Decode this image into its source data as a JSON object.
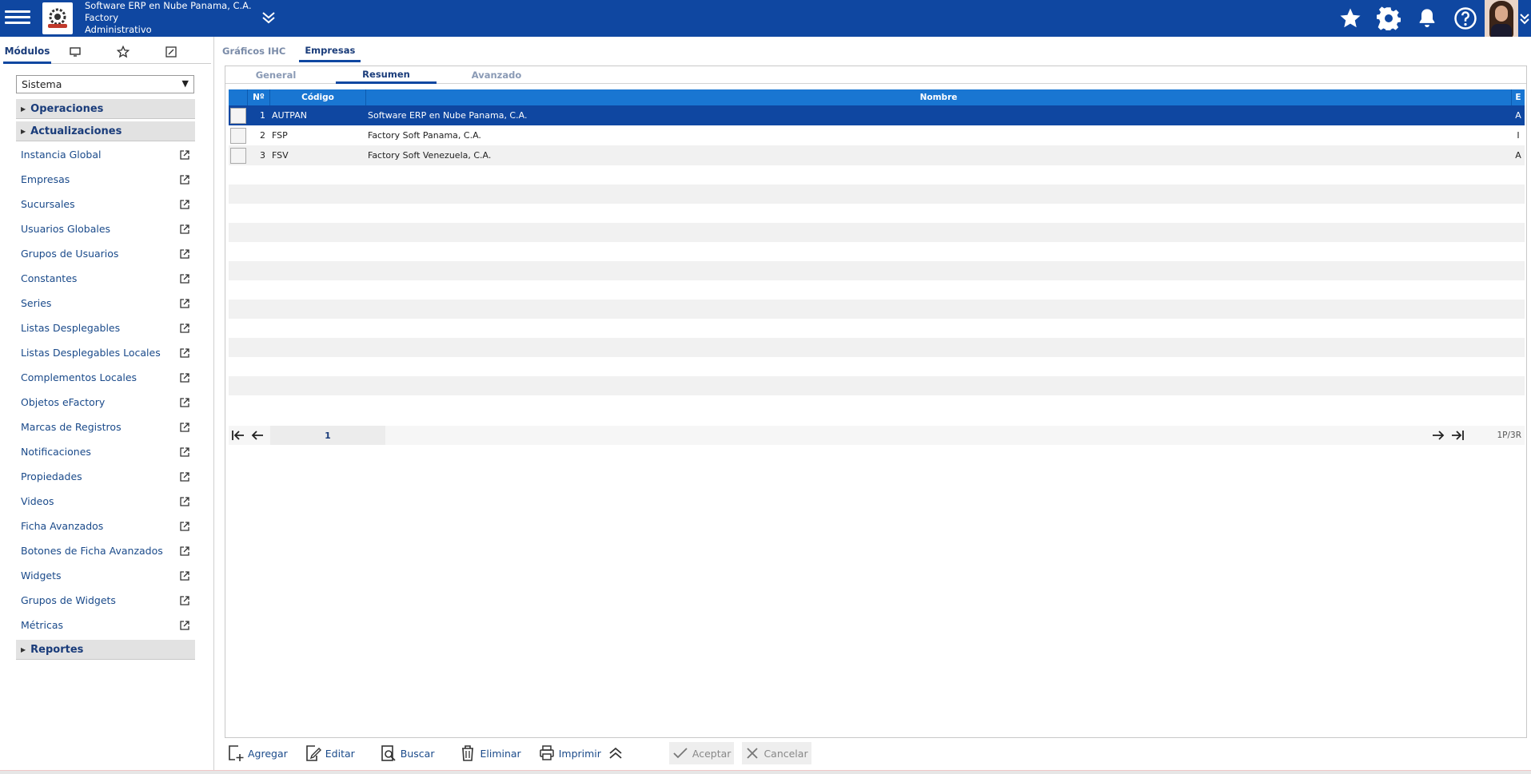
{
  "header": {
    "company": "Software ERP en Nube Panama, C.A.",
    "product": "Factory",
    "module": "Administrativo"
  },
  "sidebar": {
    "tabs": [
      "Módulos"
    ],
    "selected_module": "Sistema",
    "sections": {
      "operaciones": "Operaciones",
      "actualizaciones": "Actualizaciones",
      "reportes": "Reportes"
    },
    "items": [
      "Instancia Global",
      "Empresas",
      "Sucursales",
      "Usuarios Globales",
      "Grupos de Usuarios",
      "Constantes",
      "Series",
      "Listas Desplegables",
      "Listas Desplegables Locales",
      "Complementos Locales",
      "Objetos eFactory",
      "Marcas de Registros",
      "Notificaciones",
      "Propiedades",
      "Videos",
      "Ficha Avanzados",
      "Botones de Ficha Avanzados",
      "Widgets",
      "Grupos de Widgets",
      "Métricas"
    ]
  },
  "main_tabs": [
    "Gráficos IHC",
    "Empresas"
  ],
  "sub_tabs": [
    "General",
    "Resumen",
    "Avanzado"
  ],
  "grid": {
    "columns": [
      "Nº",
      "Código",
      "Nombre",
      "E"
    ],
    "rows": [
      {
        "num": "1",
        "code": "AUTPAN",
        "name": "Software ERP en Nube Panama, C.A.",
        "e": "A"
      },
      {
        "num": "2",
        "code": "FSP",
        "name": "Factory Soft Panama, C.A.",
        "e": "I"
      },
      {
        "num": "3",
        "code": "FSV",
        "name": "Factory Soft Venezuela, C.A.",
        "e": "A"
      }
    ]
  },
  "pager": {
    "page": "1",
    "count": "1P/3R"
  },
  "toolbar": {
    "add": "Agregar",
    "edit": "Editar",
    "search": "Buscar",
    "delete": "Eliminar",
    "print": "Imprimir",
    "accept": "Aceptar",
    "cancel": "Cancelar"
  },
  "colors": {
    "brand": "#0f47a1",
    "grid_header": "#1976d2"
  }
}
